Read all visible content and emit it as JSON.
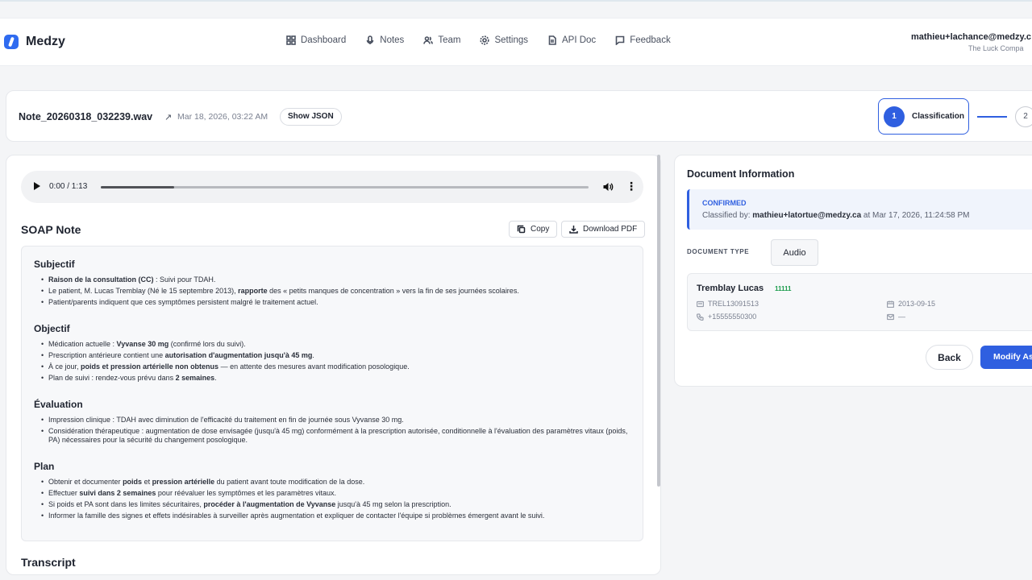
{
  "app": {
    "name": "Medzy"
  },
  "nav": {
    "dashboard": "Dashboard",
    "notes": "Notes",
    "team": "Team",
    "settings": "Settings",
    "api_doc": "API Doc",
    "feedback": "Feedback"
  },
  "user": {
    "email": "mathieu+lachance@medzy.c",
    "company": "The Luck Compa"
  },
  "note": {
    "filename": "Note_20260318_032239.wav",
    "date": "Mar 18, 2026, 03:22 AM",
    "show_json": "Show JSON"
  },
  "stepper": {
    "step1_num": "1",
    "step1_label": "Classification",
    "step2_num": "2"
  },
  "audio": {
    "time": "0:00 / 1:13",
    "progress_fraction": 0.15
  },
  "soap": {
    "title": "SOAP Note",
    "copy": "Copy",
    "download": "Download PDF",
    "sections": [
      {
        "heading": "Subjectif",
        "items": [
          "<b>Raison de la consultation (CC)</b> : Suivi pour TDAH.",
          "Le patient, M. Lucas Tremblay (Né le 15 septembre 2013), <b>rapporte</b> des « petits manques de concentration » vers la fin de ses journées scolaires.",
          "Patient/parents indiquent que ces symptômes persistent malgré le traitement actuel."
        ]
      },
      {
        "heading": "Objectif",
        "items": [
          "Médication actuelle : <b>Vyvanse 30 mg</b> (confirmé lors du suivi).",
          "Prescription antérieure contient une <b>autorisation d'augmentation jusqu'à 45 mg</b>.",
          "À ce jour, <b>poids et pression artérielle non obtenus</b> — en attente des mesures avant modification posologique.",
          "Plan de suivi : rendez-vous prévu dans <b>2 semaines</b>."
        ]
      },
      {
        "heading": "Évaluation",
        "items": [
          "Impression clinique : TDAH avec diminution de l'efficacité du traitement en fin de journée sous Vyvanse 30 mg.",
          "Considération thérapeutique : augmentation de dose envisagée (jusqu'à 45 mg) conformément à la prescription autorisée, conditionnelle à l'évaluation des paramètres vitaux (poids, PA) nécessaires pour la sécurité du changement posologique."
        ]
      },
      {
        "heading": "Plan",
        "items": [
          "Obtenir et documenter <b>poids</b> et <b>pression artérielle</b> du patient avant toute modification de la dose.",
          "Effectuer <b>suivi dans 2 semaines</b> pour réévaluer les symptômes et les paramètres vitaux.",
          "Si poids et PA sont dans les limites sécuritaires, <b>procéder à l'augmentation de Vyvanse</b> jusqu'à 45 mg selon la prescription.",
          "Informer la famille des signes et effets indésirables à surveiller après augmentation et expliquer de contacter l'équipe si problèmes émergent avant le suivi."
        ]
      }
    ]
  },
  "transcript": {
    "title": "Transcript"
  },
  "doc_info": {
    "title": "Document Information",
    "status": "CONFIRMED",
    "classified_prefix": "Classified by: ",
    "classified_by": "mathieu+latortue@medzy.ca",
    "classified_suffix": " at Mar 17, 2026, 11:24:58 PM",
    "doc_type_label": "DOCUMENT TYPE",
    "doc_type_value": "Audio"
  },
  "patient": {
    "name": "Tremblay Lucas",
    "badge": "11111",
    "record": "TREL13091513",
    "phone": "+15555550300",
    "dob": "2013-09-15",
    "email": "—"
  },
  "actions": {
    "back": "Back",
    "modify": "Modify As"
  },
  "colors": {
    "accent": "#2f5fe0",
    "badge_green": "#1a9b4b"
  }
}
